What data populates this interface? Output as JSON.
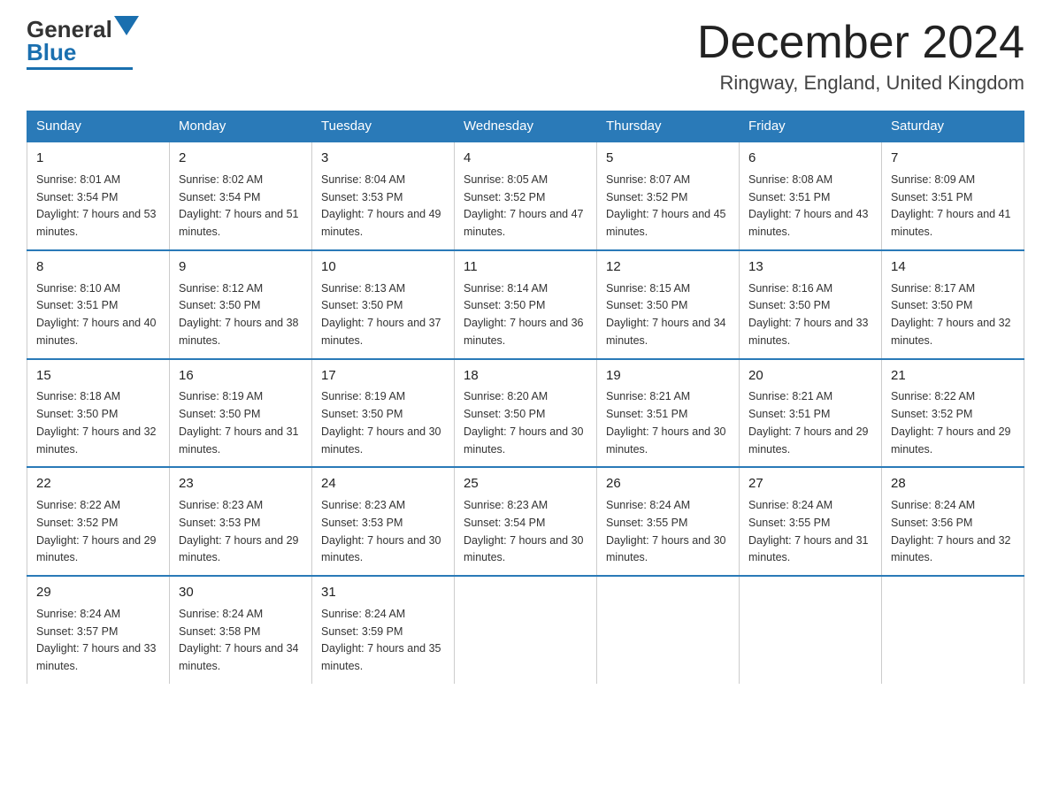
{
  "header": {
    "logo_general": "General",
    "logo_blue": "Blue",
    "month_title": "December 2024",
    "location": "Ringway, England, United Kingdom"
  },
  "days_of_week": [
    "Sunday",
    "Monday",
    "Tuesday",
    "Wednesday",
    "Thursday",
    "Friday",
    "Saturday"
  ],
  "weeks": [
    [
      {
        "day": "1",
        "sunrise": "8:01 AM",
        "sunset": "3:54 PM",
        "daylight": "7 hours and 53 minutes."
      },
      {
        "day": "2",
        "sunrise": "8:02 AM",
        "sunset": "3:54 PM",
        "daylight": "7 hours and 51 minutes."
      },
      {
        "day": "3",
        "sunrise": "8:04 AM",
        "sunset": "3:53 PM",
        "daylight": "7 hours and 49 minutes."
      },
      {
        "day": "4",
        "sunrise": "8:05 AM",
        "sunset": "3:52 PM",
        "daylight": "7 hours and 47 minutes."
      },
      {
        "day": "5",
        "sunrise": "8:07 AM",
        "sunset": "3:52 PM",
        "daylight": "7 hours and 45 minutes."
      },
      {
        "day": "6",
        "sunrise": "8:08 AM",
        "sunset": "3:51 PM",
        "daylight": "7 hours and 43 minutes."
      },
      {
        "day": "7",
        "sunrise": "8:09 AM",
        "sunset": "3:51 PM",
        "daylight": "7 hours and 41 minutes."
      }
    ],
    [
      {
        "day": "8",
        "sunrise": "8:10 AM",
        "sunset": "3:51 PM",
        "daylight": "7 hours and 40 minutes."
      },
      {
        "day": "9",
        "sunrise": "8:12 AM",
        "sunset": "3:50 PM",
        "daylight": "7 hours and 38 minutes."
      },
      {
        "day": "10",
        "sunrise": "8:13 AM",
        "sunset": "3:50 PM",
        "daylight": "7 hours and 37 minutes."
      },
      {
        "day": "11",
        "sunrise": "8:14 AM",
        "sunset": "3:50 PM",
        "daylight": "7 hours and 36 minutes."
      },
      {
        "day": "12",
        "sunrise": "8:15 AM",
        "sunset": "3:50 PM",
        "daylight": "7 hours and 34 minutes."
      },
      {
        "day": "13",
        "sunrise": "8:16 AM",
        "sunset": "3:50 PM",
        "daylight": "7 hours and 33 minutes."
      },
      {
        "day": "14",
        "sunrise": "8:17 AM",
        "sunset": "3:50 PM",
        "daylight": "7 hours and 32 minutes."
      }
    ],
    [
      {
        "day": "15",
        "sunrise": "8:18 AM",
        "sunset": "3:50 PM",
        "daylight": "7 hours and 32 minutes."
      },
      {
        "day": "16",
        "sunrise": "8:19 AM",
        "sunset": "3:50 PM",
        "daylight": "7 hours and 31 minutes."
      },
      {
        "day": "17",
        "sunrise": "8:19 AM",
        "sunset": "3:50 PM",
        "daylight": "7 hours and 30 minutes."
      },
      {
        "day": "18",
        "sunrise": "8:20 AM",
        "sunset": "3:50 PM",
        "daylight": "7 hours and 30 minutes."
      },
      {
        "day": "19",
        "sunrise": "8:21 AM",
        "sunset": "3:51 PM",
        "daylight": "7 hours and 30 minutes."
      },
      {
        "day": "20",
        "sunrise": "8:21 AM",
        "sunset": "3:51 PM",
        "daylight": "7 hours and 29 minutes."
      },
      {
        "day": "21",
        "sunrise": "8:22 AM",
        "sunset": "3:52 PM",
        "daylight": "7 hours and 29 minutes."
      }
    ],
    [
      {
        "day": "22",
        "sunrise": "8:22 AM",
        "sunset": "3:52 PM",
        "daylight": "7 hours and 29 minutes."
      },
      {
        "day": "23",
        "sunrise": "8:23 AM",
        "sunset": "3:53 PM",
        "daylight": "7 hours and 29 minutes."
      },
      {
        "day": "24",
        "sunrise": "8:23 AM",
        "sunset": "3:53 PM",
        "daylight": "7 hours and 30 minutes."
      },
      {
        "day": "25",
        "sunrise": "8:23 AM",
        "sunset": "3:54 PM",
        "daylight": "7 hours and 30 minutes."
      },
      {
        "day": "26",
        "sunrise": "8:24 AM",
        "sunset": "3:55 PM",
        "daylight": "7 hours and 30 minutes."
      },
      {
        "day": "27",
        "sunrise": "8:24 AM",
        "sunset": "3:55 PM",
        "daylight": "7 hours and 31 minutes."
      },
      {
        "day": "28",
        "sunrise": "8:24 AM",
        "sunset": "3:56 PM",
        "daylight": "7 hours and 32 minutes."
      }
    ],
    [
      {
        "day": "29",
        "sunrise": "8:24 AM",
        "sunset": "3:57 PM",
        "daylight": "7 hours and 33 minutes."
      },
      {
        "day": "30",
        "sunrise": "8:24 AM",
        "sunset": "3:58 PM",
        "daylight": "7 hours and 34 minutes."
      },
      {
        "day": "31",
        "sunrise": "8:24 AM",
        "sunset": "3:59 PM",
        "daylight": "7 hours and 35 minutes."
      },
      null,
      null,
      null,
      null
    ]
  ]
}
